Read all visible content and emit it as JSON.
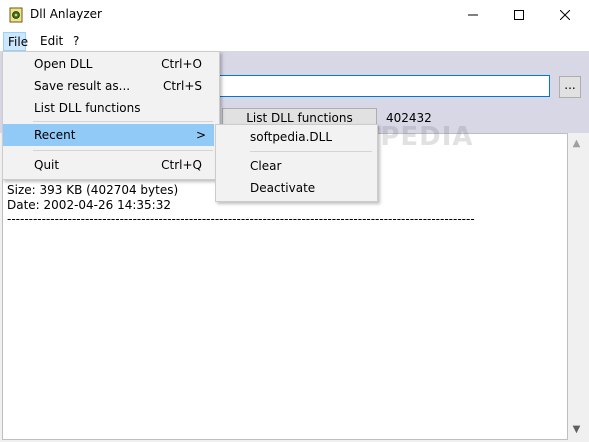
{
  "window": {
    "title": "Dll Anlayzer"
  },
  "menubar": {
    "file": "File",
    "edit": "Edit",
    "help": "?"
  },
  "toolbar": {
    "path_value": "",
    "browse_label": "...",
    "list_button_label": "List DLL functions",
    "count_value": "402432"
  },
  "output": {
    "size_line": "Size: 393 KB (402704 bytes)",
    "date_line": "Date: 2002-04-26 14:35:32",
    "separator_line": "------------------------------------------------------------------------------------------------------------"
  },
  "file_menu": {
    "items": [
      {
        "label": "Open DLL",
        "shortcut": "Ctrl+O"
      },
      {
        "label": "Save result as...",
        "shortcut": "Ctrl+S"
      },
      {
        "label": "List DLL functions",
        "shortcut": ""
      },
      {
        "label": "Recent",
        "shortcut": ""
      },
      {
        "label": "Quit",
        "shortcut": "Ctrl+Q"
      }
    ],
    "submenu_arrow": ">"
  },
  "recent_menu": {
    "items": [
      {
        "label": "softpedia.DLL"
      },
      {
        "label": "Clear"
      },
      {
        "label": "Deactivate"
      }
    ]
  },
  "watermark": "SOFTPEDIA",
  "icons": {
    "app": "dll-app-icon",
    "minimize": "minimize-icon",
    "maximize": "maximize-icon",
    "close": "close-icon",
    "scroll_up": "scroll-up-arrow-icon",
    "scroll_down": "scroll-down-arrow-icon"
  },
  "colors": {
    "accent": "#0078d7",
    "menu_highlight": "#91c9f7",
    "toolbar_bg": "#d7d7e6"
  }
}
